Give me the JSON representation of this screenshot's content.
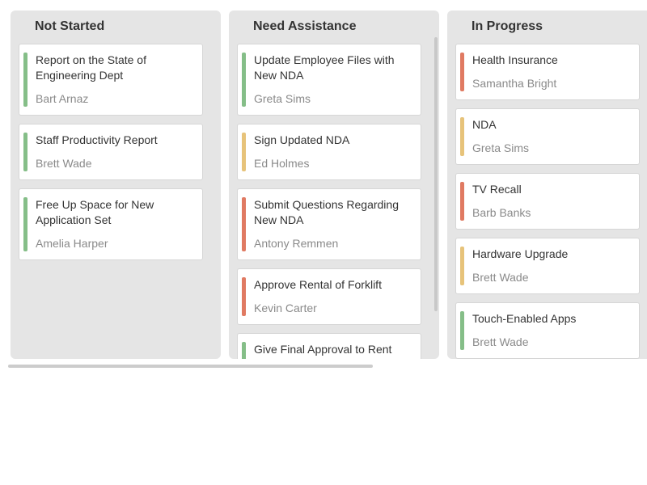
{
  "colors": {
    "green": "#85be88",
    "yellow": "#e7c37a",
    "red": "#e07a62",
    "column_bg": "#e5e5e5",
    "card_bg": "#ffffff"
  },
  "columns": [
    {
      "title": "Not Started",
      "cards": [
        {
          "title": "Report on the State of Engineering Dept",
          "owner": "Bart Arnaz",
          "status": "green"
        },
        {
          "title": "Staff Productivity Report",
          "owner": "Brett Wade",
          "status": "green"
        },
        {
          "title": "Free Up Space for New Application Set",
          "owner": "Amelia Harper",
          "status": "green"
        }
      ]
    },
    {
      "title": "Need Assistance",
      "cards": [
        {
          "title": "Update Employee Files with New NDA",
          "owner": "Greta Sims",
          "status": "green"
        },
        {
          "title": "Sign Updated NDA",
          "owner": "Ed Holmes",
          "status": "yellow"
        },
        {
          "title": "Submit Questions Regarding New NDA",
          "owner": "Antony Remmen",
          "status": "red"
        },
        {
          "title": "Approve Rental of Forklift",
          "owner": "Kevin Carter",
          "status": "red"
        },
        {
          "title": "Give Final Approval to Rent",
          "owner": "",
          "status": "green"
        }
      ]
    },
    {
      "title": "In Progress",
      "cards": [
        {
          "title": "Health Insurance",
          "owner": "Samantha Bright",
          "status": "red"
        },
        {
          "title": "NDA",
          "owner": "Greta Sims",
          "status": "yellow"
        },
        {
          "title": "TV Recall",
          "owner": "Barb Banks",
          "status": "red"
        },
        {
          "title": "Hardware Upgrade",
          "owner": "Brett Wade",
          "status": "yellow"
        },
        {
          "title": "Touch-Enabled Apps",
          "owner": "Brett Wade",
          "status": "green"
        }
      ]
    }
  ]
}
